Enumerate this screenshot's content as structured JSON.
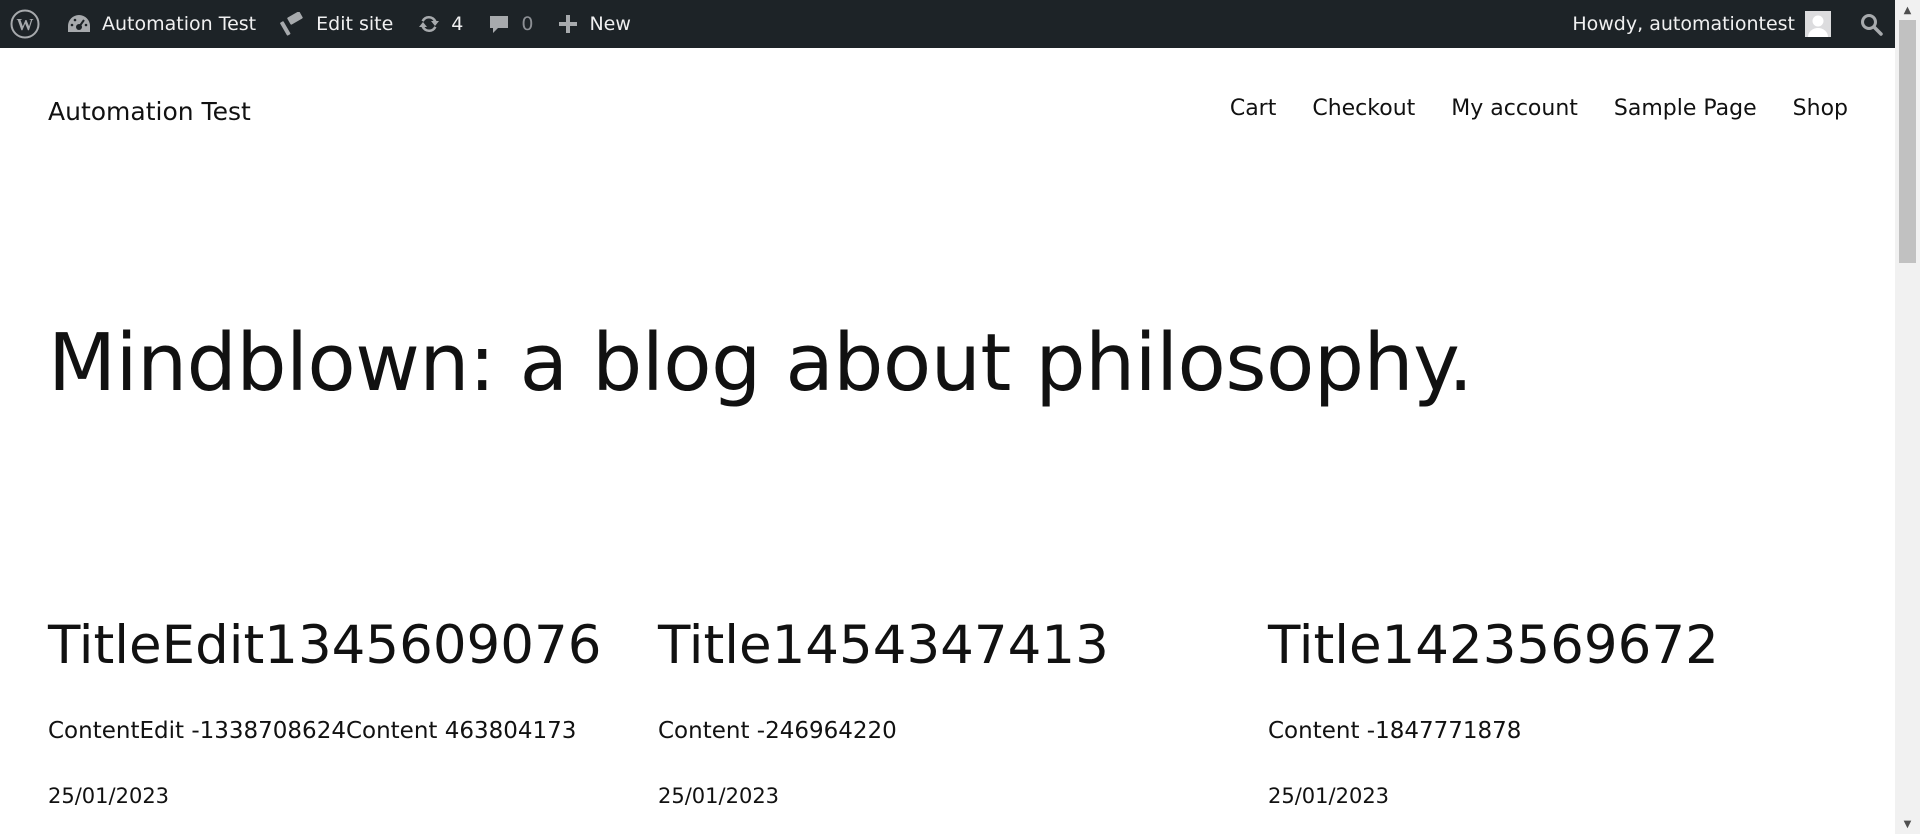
{
  "admin_bar": {
    "site_name": "Automation Test",
    "edit_site_label": "Edit site",
    "updates_count": "4",
    "comments_count": "0",
    "new_label": "New",
    "greeting": "Howdy, automationtest",
    "icons": {
      "wp": "wordpress-logo-icon",
      "site": "dashboard-icon",
      "edit": "hammer-icon",
      "updates": "refresh-icon",
      "comments": "comment-icon",
      "new": "plus-icon",
      "avatar": "user-avatar-icon",
      "search": "search-icon"
    }
  },
  "site": {
    "title": "Automation Test",
    "nav": [
      "Cart",
      "Checkout",
      "My account",
      "Sample Page",
      "Shop"
    ]
  },
  "hero": {
    "title": "Mindblown: a blog about philosophy."
  },
  "posts": [
    {
      "title": "TitleEdit1345609076",
      "excerpt": "ContentEdit -1338708624Content 463804173",
      "date": "25/01/2023"
    },
    {
      "title": "Title1454347413",
      "excerpt": "Content -246964220",
      "date": "25/01/2023"
    },
    {
      "title": "Title1423569672",
      "excerpt": "Content -1847771878",
      "date": "25/01/2023"
    }
  ],
  "colors": {
    "admin_bar_bg": "#1d2327",
    "admin_bar_text": "#f0f0f1",
    "admin_icon": "#a7aaad",
    "page_bg": "#ffffff",
    "text": "#111111"
  }
}
